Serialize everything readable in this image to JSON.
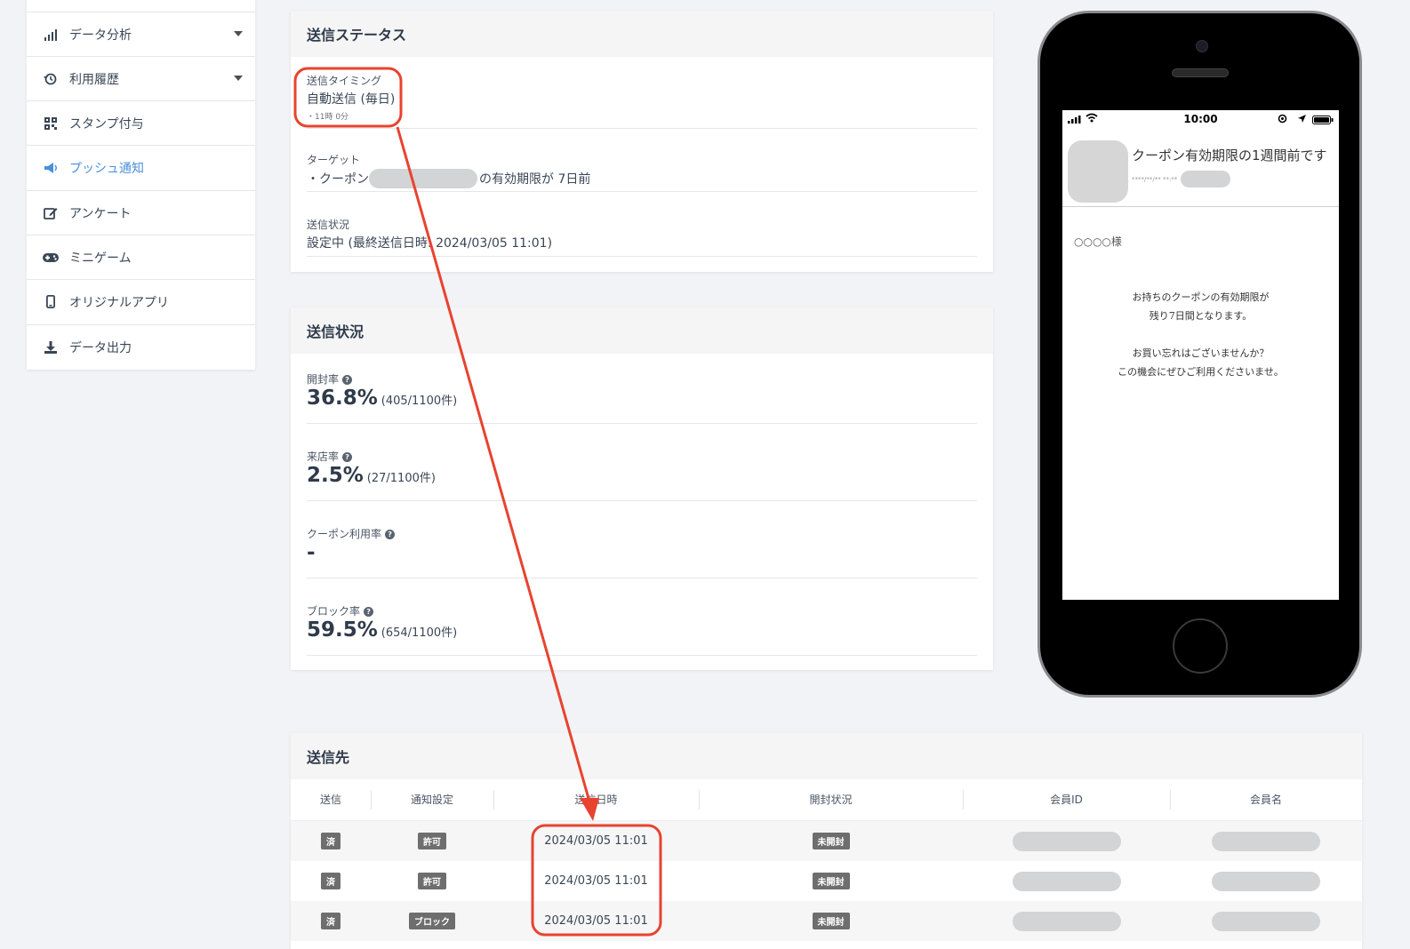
{
  "sidebar": {
    "items": [
      {
        "label": "データ分析",
        "icon": "bar-chart-icon"
      },
      {
        "label": "利用履歴",
        "icon": "history-icon"
      },
      {
        "label": "スタンプ付与",
        "icon": "qr-code-icon"
      },
      {
        "label": "プッシュ通知",
        "icon": "megaphone-icon"
      },
      {
        "label": "アンケート",
        "icon": "edit-icon"
      },
      {
        "label": "ミニゲーム",
        "icon": "gamepad-icon"
      },
      {
        "label": "オリジナルアプリ",
        "icon": "smartphone-icon"
      },
      {
        "label": "データ出力",
        "icon": "download-icon"
      }
    ]
  },
  "status_card": {
    "title": "送信ステータス",
    "timing_label": "送信タイミング",
    "timing_value": "自動送信 (毎日)",
    "timing_sub": "・11時 0分",
    "target_label": "ターゲット",
    "target_prefix": "・クーポン",
    "target_suffix": "の有効期限が 7日前",
    "state_label": "送信状況",
    "state_value": "設定中 (最終送信日時: 2024/03/05 11:01)"
  },
  "stats_card": {
    "title": "送信状況",
    "open_label": "開封率",
    "open_value": "36.8%",
    "open_detail": "(405/1100件)",
    "visit_label": "来店率",
    "visit_value": "2.5%",
    "visit_detail": "(27/1100件)",
    "coupon_label": "クーポン利用率",
    "coupon_value": "-",
    "block_label": "ブロック率",
    "block_value": "59.5%",
    "block_detail": "(654/1100件)"
  },
  "recipients": {
    "title": "送信先",
    "columns": [
      "送信",
      "通知設定",
      "送信日時",
      "開封状況",
      "会員ID",
      "会員名"
    ],
    "rows": [
      {
        "sent": "済",
        "setting": "許可",
        "datetime": "2024/03/05 11:01",
        "open": "未開封"
      },
      {
        "sent": "済",
        "setting": "許可",
        "datetime": "2024/03/05 11:01",
        "open": "未開封"
      },
      {
        "sent": "済",
        "setting": "ブロック",
        "datetime": "2024/03/05 11:01",
        "open": "未開封"
      }
    ]
  },
  "phone": {
    "time": "10:00",
    "message_title": "クーポン有効期限の1週間前です",
    "message_sub": "****/**/** **:**",
    "greeting": "○○○○様",
    "body_line1": "お持ちのクーポンの有効期限が",
    "body_line2": "残り7日間となります。",
    "body_line3": "お買い忘れはございませんか？",
    "body_line4": "この機会にぜひご利用くださいませ。"
  },
  "colors": {
    "accent_blue": "#4a8fdc",
    "highlight_red": "#e8432f",
    "badge_gray": "#6e6e6e"
  }
}
